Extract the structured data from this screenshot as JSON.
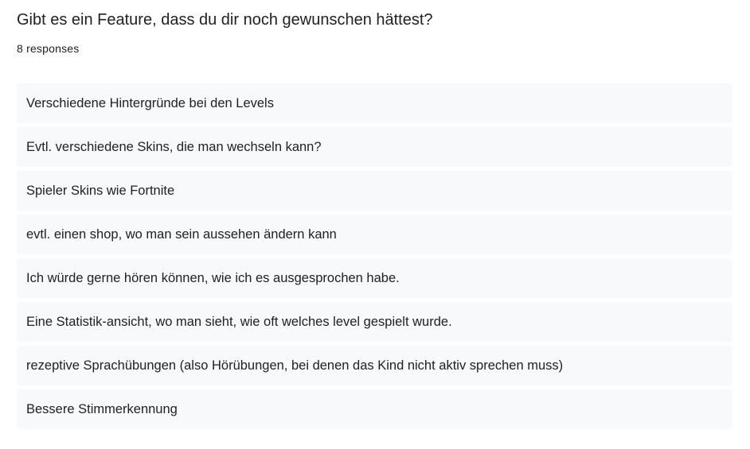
{
  "question": {
    "title": "Gibt es ein Feature, dass du dir noch gewunschen hättest?",
    "response_count": "8 responses"
  },
  "responses": [
    "Verschiedene Hintergründe bei den Levels",
    "Evtl. verschiedene Skins, die man wechseln kann?",
    "Spieler Skins wie Fortnite",
    "evtl. einen shop, wo man sein aussehen ändern kann",
    "Ich würde gerne hören können, wie ich es ausgesprochen habe.",
    "Eine Statistik-ansicht, wo man sieht, wie oft welches level gespielt wurde.",
    "rezeptive Sprachübungen (also Hörübungen, bei denen das Kind nicht aktiv sprechen muss)",
    "Bessere Stimmerkennung"
  ]
}
